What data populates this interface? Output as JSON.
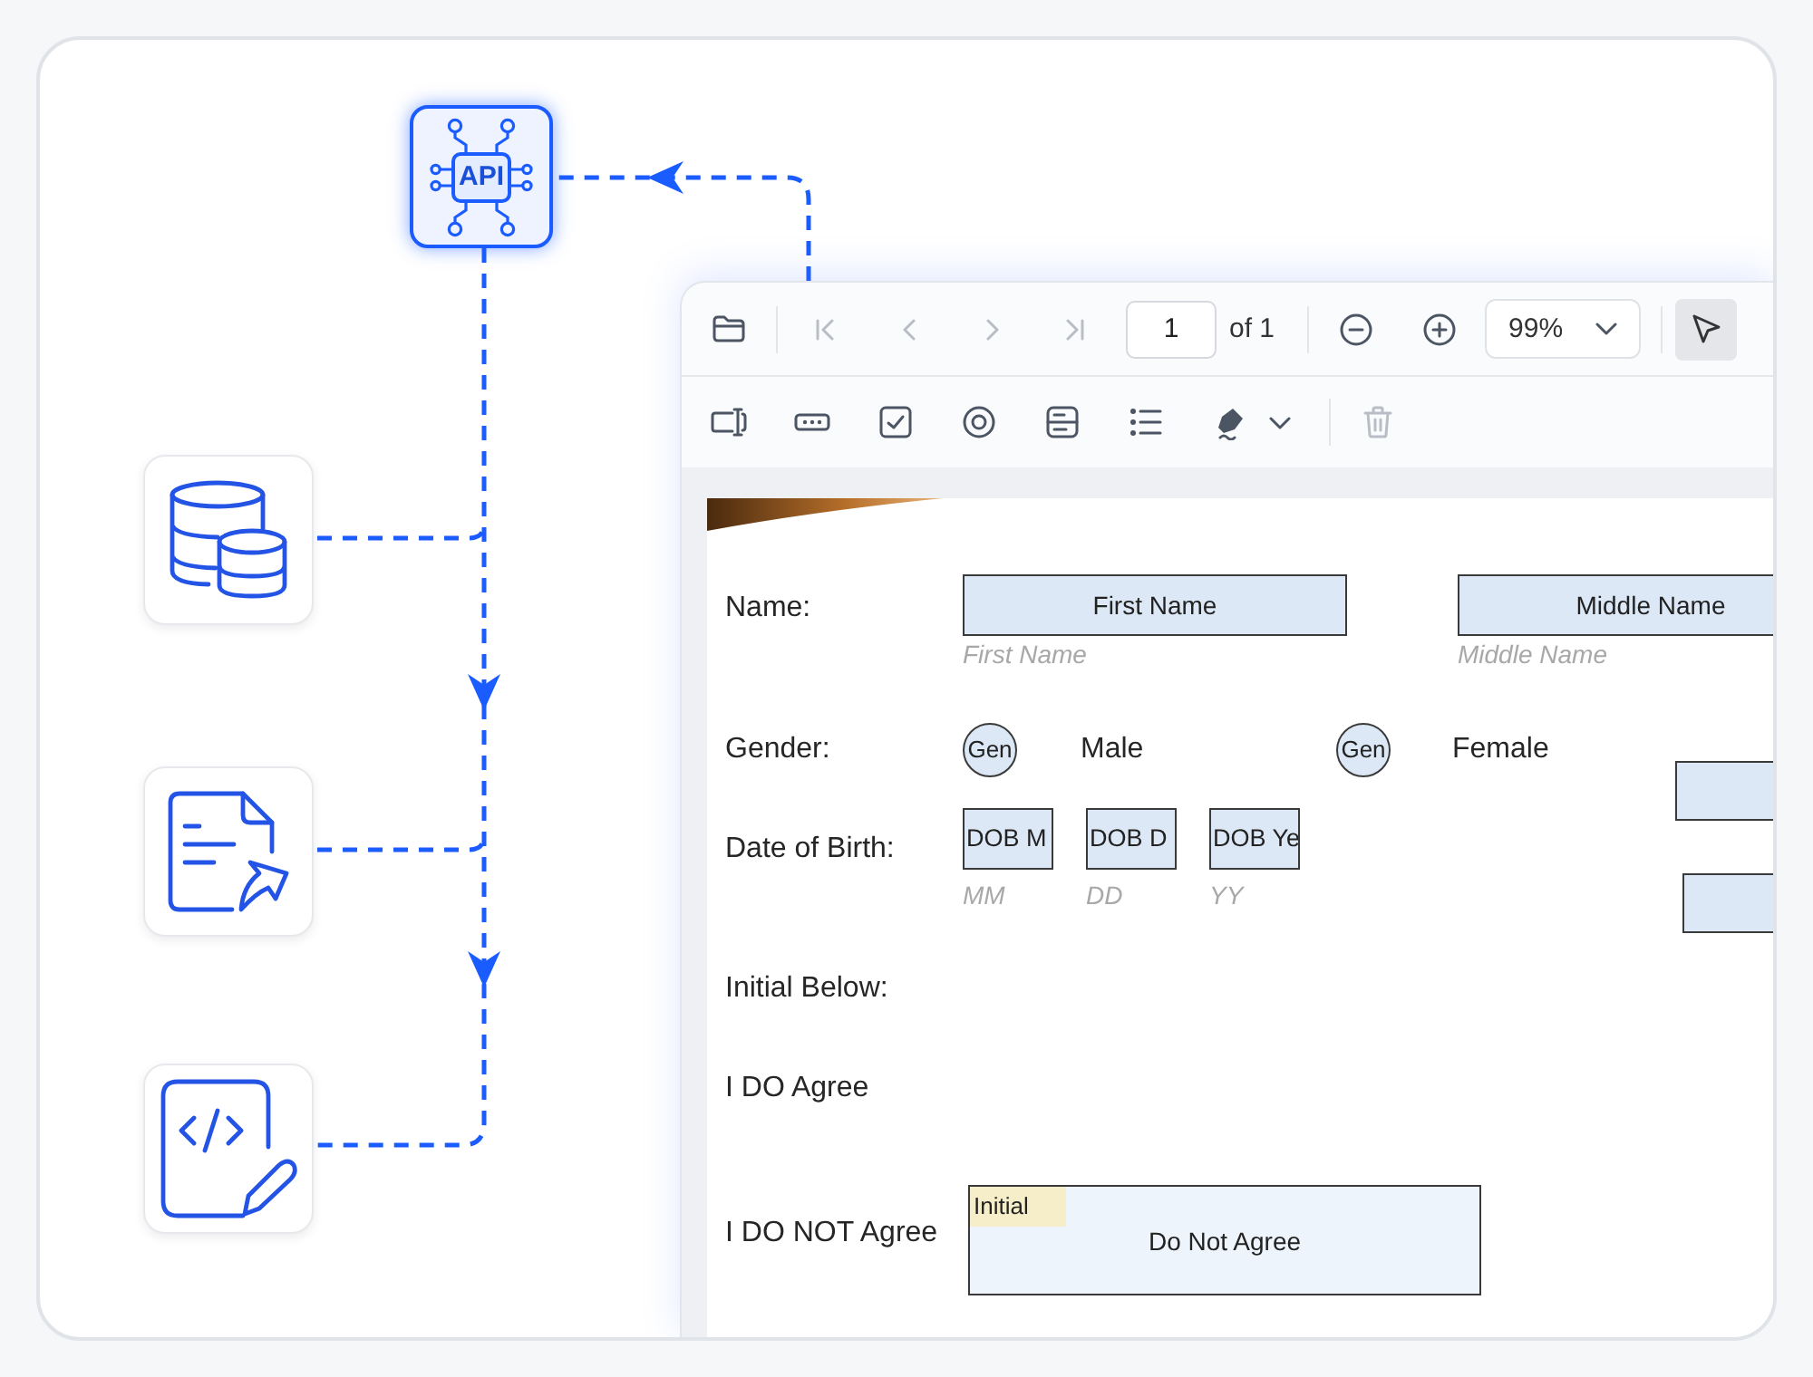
{
  "api_node": {
    "label": "API"
  },
  "viewer": {
    "toolbar": {
      "navigation": [
        {
          "kind": "first",
          "disabled": true
        },
        {
          "kind": "previous",
          "disabled": true
        },
        {
          "kind": "next",
          "disabled": true
        },
        {
          "kind": "last",
          "disabled": true
        }
      ],
      "page_input": "1",
      "page_count": "of 1",
      "zoom_buttons": [
        {
          "kind": "zoom_out",
          "disabled": false
        },
        {
          "kind": "zoom_in",
          "disabled": false
        }
      ],
      "zoom_level": "99%",
      "pointer_tool": {
        "selected": true
      }
    },
    "form_toolbar": {
      "tools": [
        {
          "kind": "textbox"
        },
        {
          "kind": "password"
        },
        {
          "kind": "checkbox"
        },
        {
          "kind": "radio"
        },
        {
          "kind": "listbox"
        },
        {
          "kind": "list"
        },
        {
          "kind": "signature"
        }
      ],
      "delete": {
        "disabled": true
      }
    },
    "page": {
      "name_row": {
        "label": "Name:",
        "fields": [
          {
            "value": "First Name",
            "caption": "First Name"
          },
          {
            "value": "Middle Name",
            "caption": "Middle Name"
          }
        ]
      },
      "gender_row": {
        "label": "Gender:",
        "options": [
          {
            "text": "Gen",
            "label": "Male"
          },
          {
            "text": "Gen",
            "label": "Female"
          }
        ]
      },
      "dob_row": {
        "label": "Date of Birth:",
        "fields": [
          {
            "value": "DOB M",
            "caption": "MM"
          },
          {
            "value": "DOB D",
            "caption": "DD"
          },
          {
            "value": "DOB Ye",
            "caption": "YY"
          }
        ]
      },
      "initial_heading": "Initial Below:",
      "agree_label": "I DO Agree",
      "not_agree_row": {
        "label": "I DO NOT Agree",
        "field": {
          "tag": "Initial",
          "value": "Do Not Agree"
        }
      }
    }
  }
}
